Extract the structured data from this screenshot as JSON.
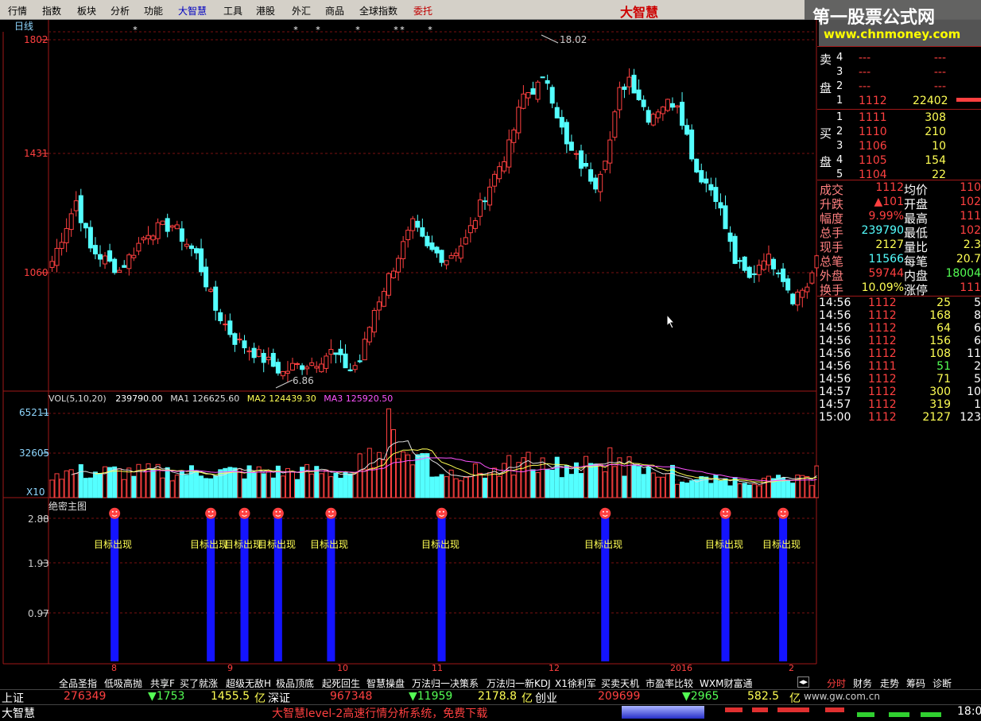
{
  "menu": {
    "items": [
      "行情",
      "指数",
      "板块",
      "分析",
      "功能",
      "大智慧",
      "工具",
      "港股",
      "外汇",
      "商品",
      "全球指数",
      "委托"
    ],
    "brand": "大智慧"
  },
  "watermark": {
    "title": "第一股票公式网",
    "url": "www.chnmoney.com"
  },
  "colors": {
    "up": "#ff4040",
    "down": "#54ffff",
    "blue_bar": "#1414ff",
    "yellow": "#ffff54",
    "grid": "#7a1010"
  },
  "panels": {
    "price": {
      "period": "日线",
      "high_label": "18.02",
      "low_label": "6.86"
    },
    "volume": {
      "label": "VOL(5,10,20)",
      "vol": "239790.00",
      "ma1_label": "MA1",
      "ma1": "126625.60",
      "ma2_label": "MA2",
      "ma2": "124439.30",
      "ma3_label": "MA3",
      "ma3": "125920.50",
      "unit": "X10"
    },
    "indicator": {
      "label": "绝密主图",
      "signal_text": "目标出现"
    }
  },
  "chart_data": [
    {
      "type": "candlestick",
      "title": "日线",
      "yticks": [
        "1802",
        "1431",
        "1060"
      ],
      "xticks": [
        "8",
        "9",
        "10",
        "11",
        "12",
        "2016",
        "2"
      ],
      "annotations": [
        "18.02",
        "6.86"
      ],
      "n_candles": 160,
      "waypoints": {
        "index": [
          0,
          5,
          8,
          14,
          20,
          25,
          30,
          34,
          38,
          42,
          48,
          50,
          55,
          58,
          62,
          64,
          67,
          72,
          75,
          78,
          82,
          86,
          90,
          95,
          98,
          103,
          107,
          111,
          113,
          116,
          118,
          120,
          124,
          127,
          130,
          134,
          138,
          142,
          145,
          148,
          151,
          154,
          157,
          159
        ],
        "close": [
          10.8,
          12.8,
          11.2,
          10.5,
          11.8,
          12.0,
          11.0,
          9.2,
          8.2,
          7.8,
          7.1,
          7.3,
          7.5,
          7.8,
          7.2,
          7.5,
          9.2,
          11.0,
          12.0,
          11.2,
          10.9,
          11.5,
          13.0,
          14.6,
          16.3,
          16.8,
          14.6,
          13.8,
          13.4,
          14.8,
          16.4,
          16.9,
          15.6,
          16.0,
          16.1,
          13.8,
          13.0,
          10.8,
          10.2,
          11.0,
          10.6,
          9.6,
          10.0,
          10.8
        ]
      },
      "ylim": [
        6.5,
        18.4
      ]
    },
    {
      "type": "bar",
      "title": "VOL(5,10,20)",
      "yticks": [
        "65211",
        "32605"
      ],
      "unit": "X10",
      "series": [
        {
          "name": "VOL",
          "last": 239790.0
        },
        {
          "name": "MA1",
          "last": 126625.6
        },
        {
          "name": "MA2",
          "last": 124439.3
        },
        {
          "name": "MA3",
          "last": 125920.5
        }
      ]
    },
    {
      "type": "bar",
      "title": "绝密主图",
      "yticks": [
        "2.88",
        "1.93",
        "0.97"
      ],
      "signal_label": "目标出现",
      "signal_candle_index": [
        13,
        33,
        40,
        47,
        58,
        81,
        115,
        140,
        152
      ],
      "ylim": [
        0,
        3.0
      ]
    }
  ],
  "orderbook": {
    "sell": [
      {
        "side": "卖",
        "level": "4",
        "price": "---",
        "vol": "---"
      },
      {
        "side": "",
        "level": "3",
        "price": "---",
        "vol": "---"
      },
      {
        "side": "盘",
        "level": "2",
        "price": "---",
        "vol": "---"
      },
      {
        "side": "",
        "level": "1",
        "price": "1112",
        "vol": "22402"
      }
    ],
    "buy": [
      {
        "side": "",
        "level": "1",
        "price": "1111",
        "vol": "308"
      },
      {
        "side": "买",
        "level": "2",
        "price": "1110",
        "vol": "210"
      },
      {
        "side": "",
        "level": "3",
        "price": "1106",
        "vol": "10"
      },
      {
        "side": "盘",
        "level": "4",
        "price": "1105",
        "vol": "154"
      },
      {
        "side": "",
        "level": "5",
        "price": "1104",
        "vol": "22"
      }
    ]
  },
  "stats": [
    {
      "k1": "成交",
      "v1": "1112",
      "k2": "均价",
      "v2": "110"
    },
    {
      "k1": "升跌",
      "v1": "▲101",
      "k2": "开盘",
      "v2": "102"
    },
    {
      "k1": "幅度",
      "v1": "9.99%",
      "k2": "最高",
      "v2": "111"
    },
    {
      "k1": "总手",
      "v1": "239790",
      "k2": "最低",
      "v2": "102"
    },
    {
      "k1": "现手",
      "v1": "2127",
      "k2": "量比",
      "v2": "2.3"
    },
    {
      "k1": "总笔",
      "v1": "11566",
      "k2": "每笔",
      "v2": "20.7"
    },
    {
      "k1": "外盘",
      "v1": "59744",
      "k2": "内盘",
      "v2": "18004"
    },
    {
      "k1": "换手",
      "v1": "10.09%",
      "k2": "涨停",
      "v2": "111"
    }
  ],
  "ticks": [
    {
      "t": "14:56",
      "p": "1112",
      "v": "25",
      "n": "5"
    },
    {
      "t": "14:56",
      "p": "1112",
      "v": "168",
      "n": "8"
    },
    {
      "t": "14:56",
      "p": "1112",
      "v": "64",
      "n": "6"
    },
    {
      "t": "14:56",
      "p": "1112",
      "v": "156",
      "n": "6"
    },
    {
      "t": "14:56",
      "p": "1112",
      "v": "108",
      "n": "11"
    },
    {
      "t": "14:56",
      "p": "1111",
      "v": "51",
      "n": "2"
    },
    {
      "t": "14:56",
      "p": "1112",
      "v": "71",
      "n": "5"
    },
    {
      "t": "14:57",
      "p": "1112",
      "v": "300",
      "n": "10"
    },
    {
      "t": "14:57",
      "p": "1112",
      "v": "319",
      "n": "1"
    },
    {
      "t": "15:00",
      "p": "1112",
      "v": "2127",
      "n": "123"
    }
  ],
  "indicator_tabs": [
    "全品圣指",
    "低吸高抛",
    "共享F",
    "买了就涨",
    "超级无敌H",
    "极品顶底",
    "起死回生",
    "智慧操盘",
    "万法归一决策系",
    "万法归一新KDJ",
    "X1徐利军",
    "买卖天机",
    "市盈率比较",
    "WXM财富通"
  ],
  "right_tabs": [
    "分时",
    "财务",
    "走势",
    "筹码",
    "诊断"
  ],
  "status": {
    "sh_label": "上证",
    "sh_value": "276349",
    "sh_change": "▼1753",
    "sh_amount": "1455.5",
    "sh_unit": "亿",
    "sz_label": "深证",
    "sz_value": "967348",
    "sz_change": "▼11959",
    "sz_amount": "2178.8",
    "sz_unit": "亿",
    "cy_label": "创业",
    "cy_value": "209699",
    "cy_change": "▼2965",
    "cy_amount": "582.5",
    "cy_unit": "亿",
    "url": "www.gw.com.cn",
    "app": "大智慧",
    "marquee": "大智慧level-2高速行情分析系统，免费下载",
    "time": "18:0"
  }
}
